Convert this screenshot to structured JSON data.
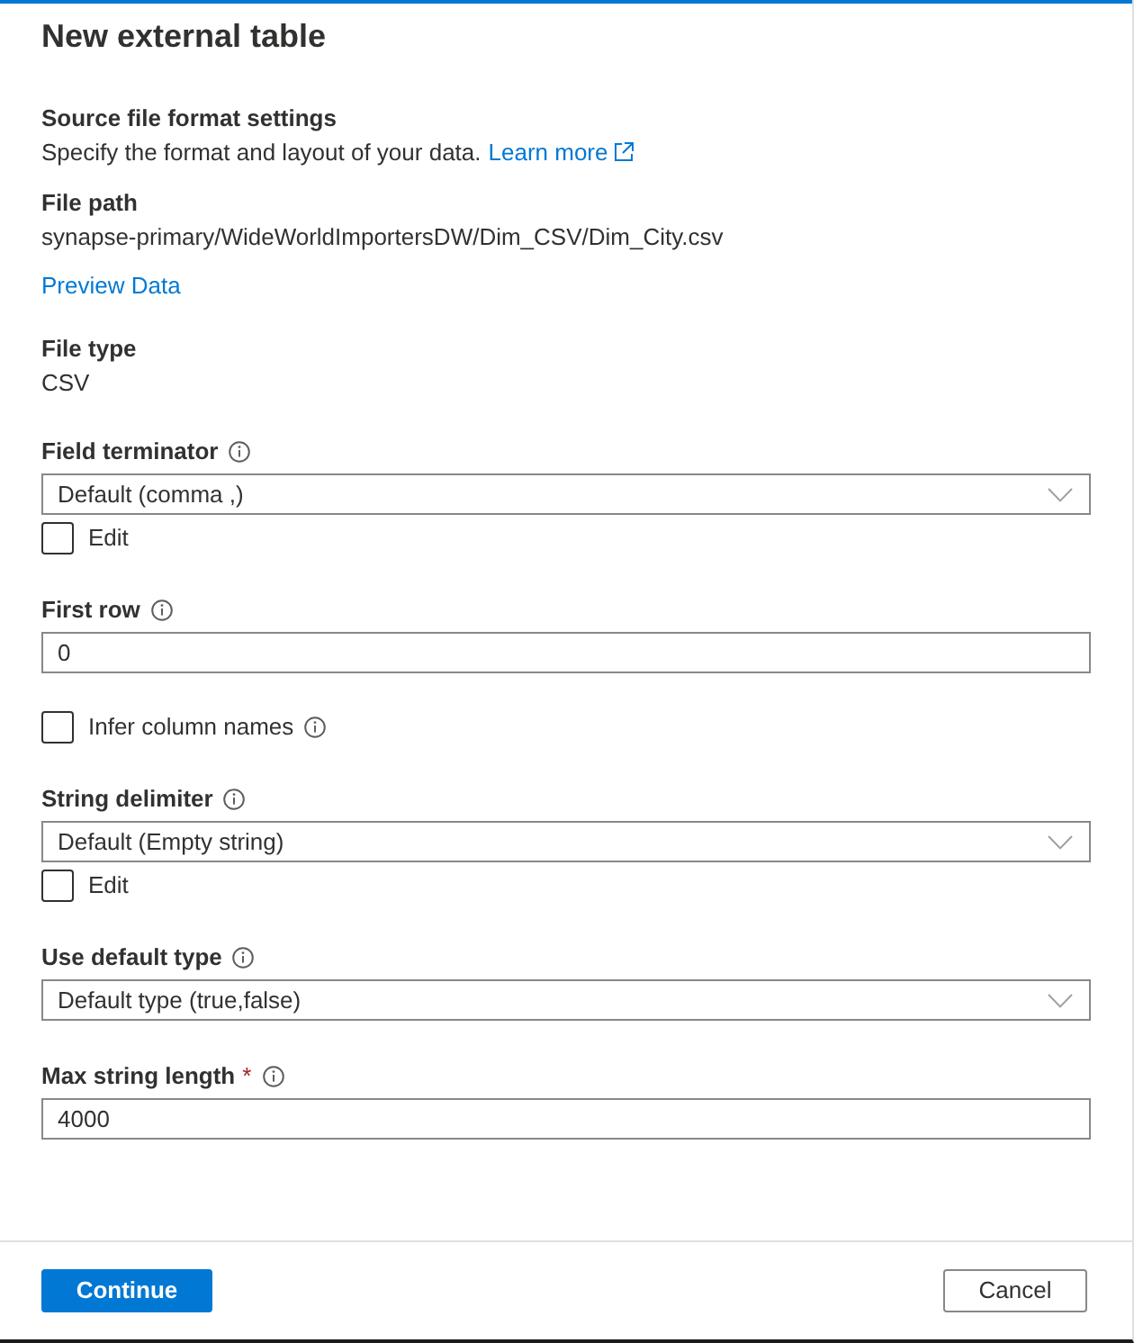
{
  "panel": {
    "title": "New external table"
  },
  "source_settings": {
    "heading": "Source file format settings",
    "description": "Specify the format and layout of your data.",
    "link": "Learn more"
  },
  "file_path": {
    "label": "File path",
    "value": "synapse-primary/WideWorldImportersDW/Dim_CSV/Dim_City.csv"
  },
  "preview_link": "Preview Data",
  "file_type": {
    "label": "File type",
    "value": "CSV"
  },
  "fields": [
    {
      "kind": "dropdown",
      "label": "Field terminator",
      "info": true,
      "value": "Default (comma ,)",
      "edit": {
        "label": "Edit",
        "checked": false
      }
    },
    {
      "kind": "input",
      "label": "First row",
      "info": true,
      "value": "0"
    },
    {
      "kind": "checkbox",
      "label": "Infer column names",
      "info": true,
      "checked": false
    },
    {
      "kind": "dropdown",
      "label": "String delimiter",
      "info": true,
      "value": "Default (Empty string)",
      "edit": {
        "label": "Edit",
        "checked": false
      }
    },
    {
      "kind": "dropdown",
      "label": "Use default type",
      "info": true,
      "value": "Default type (true,false)"
    },
    {
      "kind": "input",
      "label": "Max string length",
      "required_mark": "*",
      "info": true,
      "value": "4000"
    }
  ],
  "buttons": [
    {
      "label": "Continue",
      "kind": "primary"
    },
    {
      "label": "Cancel",
      "kind": "secondary"
    }
  ]
}
